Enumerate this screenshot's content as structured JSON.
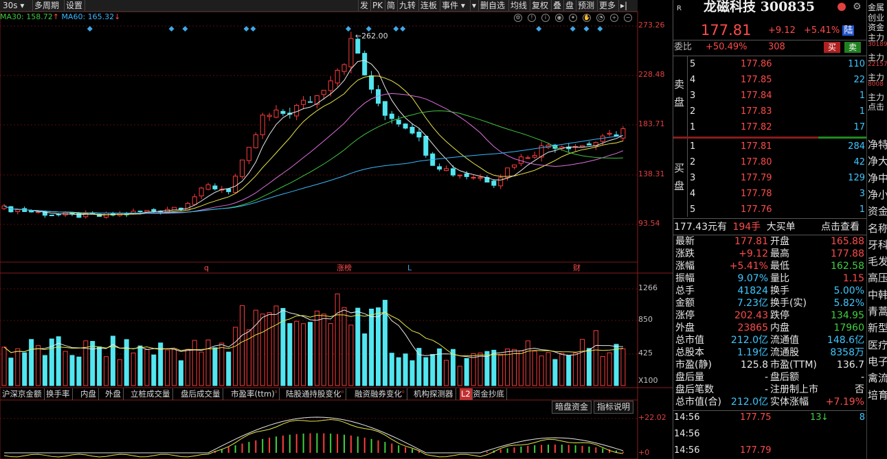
{
  "toolbar": {
    "left": [
      {
        "label": "30s ▾",
        "w": 46
      },
      {
        "label": "多周期",
        "w": 46
      },
      {
        "label": "设置",
        "w": 30
      }
    ],
    "right": [
      {
        "label": "发",
        "w": 18
      },
      {
        "label": "PK",
        "w": 21
      },
      {
        "label": "简",
        "w": 18
      },
      {
        "label": "九转",
        "w": 31
      },
      {
        "label": "连板",
        "w": 31
      },
      {
        "label": "事件 ▾",
        "w": 44
      },
      {
        "label": "▾",
        "w": 12
      },
      {
        "label": "删自选",
        "w": 44
      },
      {
        "label": "均线",
        "w": 31
      },
      {
        "label": "复权",
        "w": 31
      },
      {
        "label": "叠",
        "w": 18
      },
      {
        "label": "盘",
        "w": 18
      },
      {
        "label": "预测",
        "w": 31
      },
      {
        "label": "更多",
        "w": 31
      },
      {
        "label": "▸|",
        "w": 18
      }
    ]
  },
  "ma_legend": {
    "ma30": "MA30: 158.72",
    "ma30_color": "#3ec840",
    "ma60": "MA60: 165.32",
    "ma60_color": "#38b8ff",
    "arrow_up": "↑",
    "arrow_down": "↓"
  },
  "chart_data": {
    "type": "candlestick",
    "price_axis": {
      "ticks": [
        "273.26",
        "228.48",
        "183.71",
        "138.31",
        "93.54"
      ]
    },
    "volume_axis": {
      "ticks": [
        "1266",
        "850",
        "425"
      ],
      "unit": "X100"
    },
    "indicator_axis": {
      "ticks": [
        "+22.02",
        "+0"
      ]
    },
    "peak_label": "262.00",
    "event_markers": [
      {
        "label": "q"
      },
      {
        "label": "涨榜"
      },
      {
        "label": "L"
      },
      {
        "label": "财"
      }
    ],
    "candles": []
  },
  "indicator_tabs": [
    {
      "label": "沪深京金额",
      "w": 64
    },
    {
      "label": "换手率",
      "w": 50
    },
    {
      "label": "内盘",
      "w": 36
    },
    {
      "label": "外盘",
      "w": 37
    },
    {
      "label": "立桩成交量",
      "w": 73
    },
    {
      "label": "盘后成交量",
      "w": 73
    },
    {
      "label": "市盈率(ttm)",
      "w": 80,
      "arrow": true
    },
    {
      "label": "陆股通持股变化",
      "w": 100,
      "arrow": true
    },
    {
      "label": "融资融券变化",
      "w": 86,
      "arrow": true
    },
    {
      "label": "机构探测器",
      "w": 70
    },
    {
      "label": "L2",
      "w": 16,
      "badge": true
    },
    {
      "label": "资金抄底",
      "w": 62
    }
  ],
  "indicator_buttons": {
    "dark": "暗盘资金",
    "help": "指标说明"
  },
  "quote": {
    "r_icon": "R",
    "name": "龙磁科技",
    "code": "300835",
    "price": "177.81",
    "change": "+9.12",
    "pct": "+5.41%",
    "tag": "陆",
    "weibi_label": "委比",
    "weibi": "+50.49%",
    "weicha": "308",
    "buy_btn": "买",
    "sell_btn": "卖",
    "sell_label": [
      "卖",
      "盘"
    ],
    "buy_label": [
      "买",
      "盘"
    ],
    "asks": [
      {
        "lvl": "5",
        "price": "177.86",
        "vol": "110"
      },
      {
        "lvl": "4",
        "price": "177.85",
        "vol": "22"
      },
      {
        "lvl": "3",
        "price": "177.84",
        "vol": "1"
      },
      {
        "lvl": "2",
        "price": "177.83",
        "vol": "1"
      },
      {
        "lvl": "1",
        "price": "177.82",
        "vol": "17"
      }
    ],
    "bids": [
      {
        "lvl": "1",
        "price": "177.81",
        "vol": "284"
      },
      {
        "lvl": "2",
        "price": "177.80",
        "vol": "42"
      },
      {
        "lvl": "3",
        "price": "177.79",
        "vol": "129"
      },
      {
        "lvl": "4",
        "price": "177.78",
        "vol": "3"
      },
      {
        "lvl": "5",
        "price": "177.76",
        "vol": "1"
      }
    ],
    "bigorder": {
      "amount": "177.43元有",
      "hands": "194手",
      "label": "大买单",
      "link": "点击查看"
    },
    "stats": [
      {
        "l": "最新",
        "v": "177.81",
        "c": "red",
        "l2": "开盘",
        "v2": "165.88",
        "c2": "red"
      },
      {
        "l": "涨跌",
        "v": "+9.12",
        "c": "red",
        "l2": "最高",
        "v2": "177.88",
        "c2": "red"
      },
      {
        "l": "涨幅",
        "v": "+5.41%",
        "c": "red",
        "l2": "最低",
        "v2": "162.58",
        "c2": "grn"
      },
      {
        "l": "振幅",
        "v": "9.07%",
        "c": "cyan",
        "l2": "量比",
        "v2": "1.15",
        "c2": "red"
      },
      {
        "l": "总手",
        "v": "41824",
        "c": "cyan",
        "l2": "换手",
        "v2": "5.00%",
        "c2": "cyan"
      },
      {
        "l": "金额",
        "v": "7.23亿",
        "c": "cyan",
        "l2": "换手(实)",
        "v2": "5.82%",
        "c2": "cyan"
      },
      {
        "l": "涨停",
        "v": "202.43",
        "c": "red",
        "l2": "跌停",
        "v2": "134.95",
        "c2": "grn"
      },
      {
        "l": "外盘",
        "v": "23865",
        "c": "red",
        "l2": "内盘",
        "v2": "17960",
        "c2": "grn"
      },
      {
        "l": "总市值",
        "v": "212.0亿",
        "c": "cyan",
        "l2": "流通值",
        "v2": "148.6亿",
        "c2": "cyan"
      },
      {
        "l": "总股本",
        "v": "1.19亿",
        "c": "cyan",
        "l2": "流通股",
        "v2": "8358万",
        "c2": "cyan"
      },
      {
        "l": "市盈(静)",
        "v": "125.8",
        "c": "wht",
        "l2": "市盈(TTM)",
        "v2": "136.7",
        "c2": "wht"
      },
      {
        "l": "盘后量",
        "v": "-",
        "c": "wht",
        "l2": "盘后额",
        "v2": "-",
        "c2": "wht"
      },
      {
        "l": "盘后笔数",
        "v": "-",
        "c": "wht",
        "l2": "注册制上市",
        "v2": "否",
        "c2": "wht"
      },
      {
        "l": "总市值(合)",
        "v": "212.0亿",
        "c": "cyan",
        "l2": "实体涨幅",
        "v2": "+7.19%",
        "c2": "red"
      }
    ],
    "ticks": [
      {
        "t": "14:56",
        "p": "177.75",
        "v": "13",
        "arr": "↓",
        "n": "8"
      },
      {
        "t": "14:56",
        "p": "",
        "v": "",
        "arr": "",
        "n": ""
      },
      {
        "t": "14:56",
        "p": "177.79",
        "v": "",
        "arr": "",
        "n": ""
      }
    ]
  },
  "far_right": {
    "items": [
      "金属",
      "创业",
      "资金",
      "主力",
      "30189",
      "主力",
      "22157",
      "主力",
      "8008",
      "主力",
      "点击",
      "净特",
      "净大",
      "净中",
      "净小",
      "资金",
      "名称",
      "牙科",
      "毛发",
      "高压",
      "中韩",
      "青蒿",
      "新型",
      "医疗",
      "电子",
      "禽流",
      "培育"
    ]
  }
}
